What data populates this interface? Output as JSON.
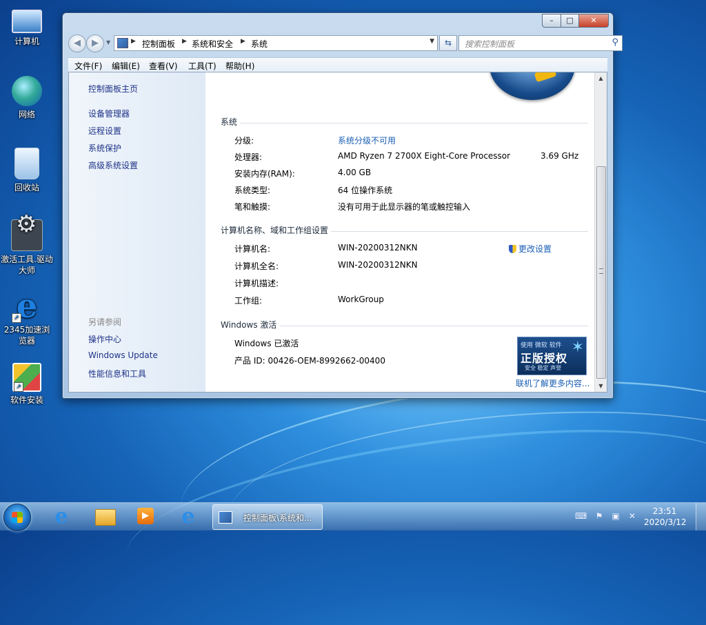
{
  "desktop": {
    "icons": [
      {
        "label": "计算机"
      },
      {
        "label": "网络"
      },
      {
        "label": "回收站"
      },
      {
        "label": "激活工具.驱动大师"
      },
      {
        "label": "2345加速浏览器"
      },
      {
        "label": "软件安装"
      }
    ]
  },
  "window": {
    "caption_buttons": {
      "minimize": "–",
      "maximize": "□",
      "close": "✕"
    },
    "breadcrumb": [
      "控制面板",
      "系统和安全",
      "系统"
    ],
    "search_placeholder": "搜索控制面板",
    "menu": [
      "文件(F)",
      "编辑(E)",
      "查看(V)",
      "工具(T)",
      "帮助(H)"
    ],
    "left_pane": {
      "home": "控制面板主页",
      "links": [
        "设备管理器",
        "远程设置",
        "系统保护",
        "高级系统设置"
      ],
      "see_also_title": "另请参阅",
      "see_also": [
        "操作中心",
        "Windows Update",
        "性能信息和工具"
      ]
    },
    "system": {
      "title": "系统",
      "rating_label": "分级:",
      "rating_value": "系统分级不可用",
      "cpu_label": "处理器:",
      "cpu_value": "AMD Ryzen 7 2700X Eight-Core Processor",
      "cpu_speed": "3.69 GHz",
      "ram_label": "安装内存(RAM):",
      "ram_value": "4.00 GB",
      "type_label": "系统类型:",
      "type_value": "64 位操作系统",
      "pen_label": "笔和触摸:",
      "pen_value": "没有可用于此显示器的笔或触控输入"
    },
    "computer": {
      "title": "计算机名称、域和工作组设置",
      "name_label": "计算机名:",
      "name_value": "WIN-20200312NKN",
      "fullname_label": "计算机全名:",
      "fullname_value": "WIN-20200312NKN",
      "desc_label": "计算机描述:",
      "desc_value": "",
      "workgroup_label": "工作组:",
      "workgroup_value": "WorkGroup",
      "change_settings": "更改设置"
    },
    "activation": {
      "title": "Windows 激活",
      "status": "Windows 已激活",
      "product_id": "产品 ID: 00426-OEM-8992662-00400",
      "badge_top": "使用 微软 软件",
      "badge_main": "正版授权",
      "badge_bottom": "安全 稳定 声誉",
      "learn_more": "联机了解更多内容..."
    }
  },
  "taskbar": {
    "active_task": "控制面板\\系统和...",
    "time": "23:51",
    "date": "2020/3/12"
  }
}
